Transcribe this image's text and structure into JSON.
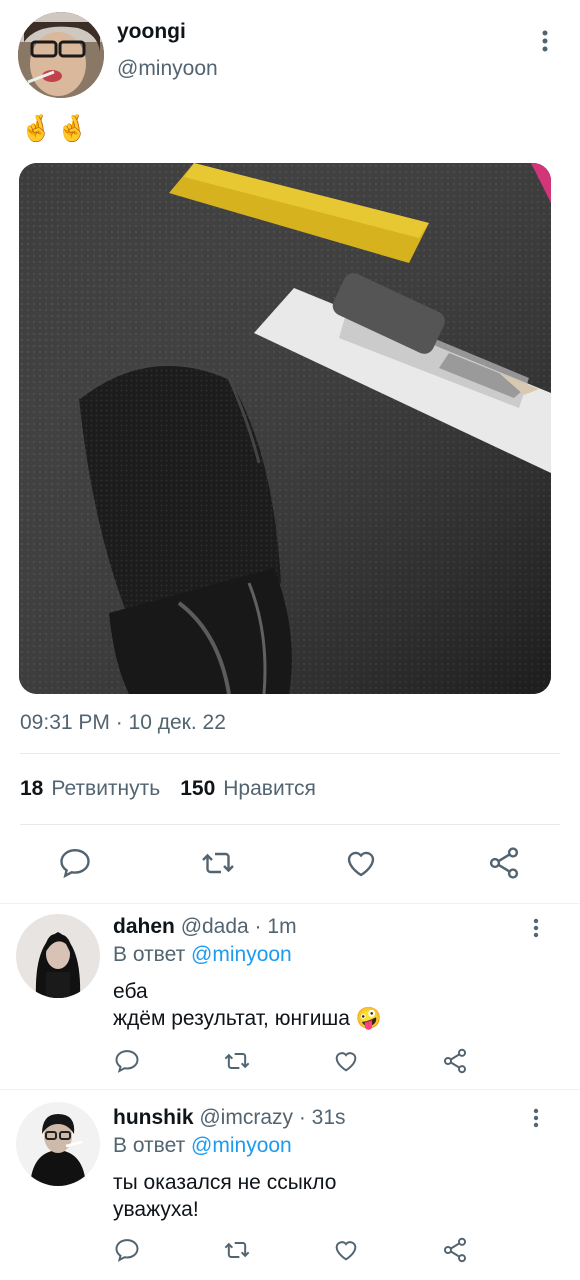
{
  "tweet": {
    "author_name": "yoongi",
    "author_handle": "@minyoon",
    "text": "🤞🤞",
    "timestamp": "09:31 PM · 10 дек. 22",
    "retweets_count": "18",
    "retweets_label": "Ретвитнуть",
    "likes_count": "150",
    "likes_label": "Нравится"
  },
  "replies": [
    {
      "name": "dahen",
      "handle_time": "@dada · 1m",
      "reply_prefix": "В ответ",
      "reply_mention": "@minyoon",
      "line1": "еба",
      "line2": "ждём результат, юнгиша 🤪"
    },
    {
      "name": "hunshik",
      "handle_time": "@imcrazy · 31s",
      "reply_prefix": "В ответ",
      "reply_mention": "@minyoon",
      "line1": "ты оказался не ссыкло",
      "line2": "уважуха!"
    }
  ],
  "colors": {
    "accent": "#1d9bf0",
    "secondary_text": "#536471",
    "primary_text": "#0f1419"
  }
}
